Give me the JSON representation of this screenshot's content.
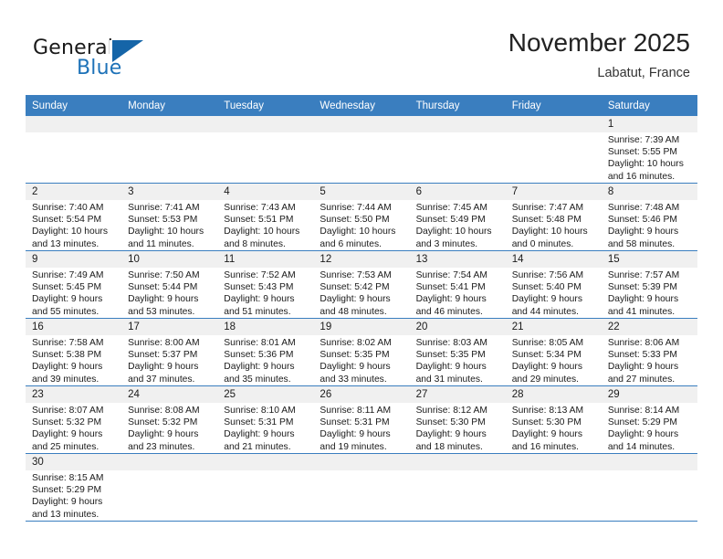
{
  "brand": {
    "name_part1": "General",
    "name_part2": "Blue",
    "logo_icon": "triangle-logo-icon"
  },
  "header": {
    "title": "November 2025",
    "location": "Labatut, France"
  },
  "calendar": {
    "weekday_headers": [
      "Sunday",
      "Monday",
      "Tuesday",
      "Wednesday",
      "Thursday",
      "Friday",
      "Saturday"
    ],
    "accent_color": "#3a7ebf",
    "daynum_band_color": "#f0f0f0",
    "weeks": [
      [
        {
          "day": "",
          "empty": true,
          "sunrise": "",
          "sunset": "",
          "daylight1": "",
          "daylight2": ""
        },
        {
          "day": "",
          "empty": true,
          "sunrise": "",
          "sunset": "",
          "daylight1": "",
          "daylight2": ""
        },
        {
          "day": "",
          "empty": true,
          "sunrise": "",
          "sunset": "",
          "daylight1": "",
          "daylight2": ""
        },
        {
          "day": "",
          "empty": true,
          "sunrise": "",
          "sunset": "",
          "daylight1": "",
          "daylight2": ""
        },
        {
          "day": "",
          "empty": true,
          "sunrise": "",
          "sunset": "",
          "daylight1": "",
          "daylight2": ""
        },
        {
          "day": "",
          "empty": true,
          "sunrise": "",
          "sunset": "",
          "daylight1": "",
          "daylight2": ""
        },
        {
          "day": "1",
          "empty": false,
          "sunrise": "Sunrise: 7:39 AM",
          "sunset": "Sunset: 5:55 PM",
          "daylight1": "Daylight: 10 hours",
          "daylight2": "and 16 minutes."
        }
      ],
      [
        {
          "day": "2",
          "empty": false,
          "sunrise": "Sunrise: 7:40 AM",
          "sunset": "Sunset: 5:54 PM",
          "daylight1": "Daylight: 10 hours",
          "daylight2": "and 13 minutes."
        },
        {
          "day": "3",
          "empty": false,
          "sunrise": "Sunrise: 7:41 AM",
          "sunset": "Sunset: 5:53 PM",
          "daylight1": "Daylight: 10 hours",
          "daylight2": "and 11 minutes."
        },
        {
          "day": "4",
          "empty": false,
          "sunrise": "Sunrise: 7:43 AM",
          "sunset": "Sunset: 5:51 PM",
          "daylight1": "Daylight: 10 hours",
          "daylight2": "and 8 minutes."
        },
        {
          "day": "5",
          "empty": false,
          "sunrise": "Sunrise: 7:44 AM",
          "sunset": "Sunset: 5:50 PM",
          "daylight1": "Daylight: 10 hours",
          "daylight2": "and 6 minutes."
        },
        {
          "day": "6",
          "empty": false,
          "sunrise": "Sunrise: 7:45 AM",
          "sunset": "Sunset: 5:49 PM",
          "daylight1": "Daylight: 10 hours",
          "daylight2": "and 3 minutes."
        },
        {
          "day": "7",
          "empty": false,
          "sunrise": "Sunrise: 7:47 AM",
          "sunset": "Sunset: 5:48 PM",
          "daylight1": "Daylight: 10 hours",
          "daylight2": "and 0 minutes."
        },
        {
          "day": "8",
          "empty": false,
          "sunrise": "Sunrise: 7:48 AM",
          "sunset": "Sunset: 5:46 PM",
          "daylight1": "Daylight: 9 hours",
          "daylight2": "and 58 minutes."
        }
      ],
      [
        {
          "day": "9",
          "empty": false,
          "sunrise": "Sunrise: 7:49 AM",
          "sunset": "Sunset: 5:45 PM",
          "daylight1": "Daylight: 9 hours",
          "daylight2": "and 55 minutes."
        },
        {
          "day": "10",
          "empty": false,
          "sunrise": "Sunrise: 7:50 AM",
          "sunset": "Sunset: 5:44 PM",
          "daylight1": "Daylight: 9 hours",
          "daylight2": "and 53 minutes."
        },
        {
          "day": "11",
          "empty": false,
          "sunrise": "Sunrise: 7:52 AM",
          "sunset": "Sunset: 5:43 PM",
          "daylight1": "Daylight: 9 hours",
          "daylight2": "and 51 minutes."
        },
        {
          "day": "12",
          "empty": false,
          "sunrise": "Sunrise: 7:53 AM",
          "sunset": "Sunset: 5:42 PM",
          "daylight1": "Daylight: 9 hours",
          "daylight2": "and 48 minutes."
        },
        {
          "day": "13",
          "empty": false,
          "sunrise": "Sunrise: 7:54 AM",
          "sunset": "Sunset: 5:41 PM",
          "daylight1": "Daylight: 9 hours",
          "daylight2": "and 46 minutes."
        },
        {
          "day": "14",
          "empty": false,
          "sunrise": "Sunrise: 7:56 AM",
          "sunset": "Sunset: 5:40 PM",
          "daylight1": "Daylight: 9 hours",
          "daylight2": "and 44 minutes."
        },
        {
          "day": "15",
          "empty": false,
          "sunrise": "Sunrise: 7:57 AM",
          "sunset": "Sunset: 5:39 PM",
          "daylight1": "Daylight: 9 hours",
          "daylight2": "and 41 minutes."
        }
      ],
      [
        {
          "day": "16",
          "empty": false,
          "sunrise": "Sunrise: 7:58 AM",
          "sunset": "Sunset: 5:38 PM",
          "daylight1": "Daylight: 9 hours",
          "daylight2": "and 39 minutes."
        },
        {
          "day": "17",
          "empty": false,
          "sunrise": "Sunrise: 8:00 AM",
          "sunset": "Sunset: 5:37 PM",
          "daylight1": "Daylight: 9 hours",
          "daylight2": "and 37 minutes."
        },
        {
          "day": "18",
          "empty": false,
          "sunrise": "Sunrise: 8:01 AM",
          "sunset": "Sunset: 5:36 PM",
          "daylight1": "Daylight: 9 hours",
          "daylight2": "and 35 minutes."
        },
        {
          "day": "19",
          "empty": false,
          "sunrise": "Sunrise: 8:02 AM",
          "sunset": "Sunset: 5:35 PM",
          "daylight1": "Daylight: 9 hours",
          "daylight2": "and 33 minutes."
        },
        {
          "day": "20",
          "empty": false,
          "sunrise": "Sunrise: 8:03 AM",
          "sunset": "Sunset: 5:35 PM",
          "daylight1": "Daylight: 9 hours",
          "daylight2": "and 31 minutes."
        },
        {
          "day": "21",
          "empty": false,
          "sunrise": "Sunrise: 8:05 AM",
          "sunset": "Sunset: 5:34 PM",
          "daylight1": "Daylight: 9 hours",
          "daylight2": "and 29 minutes."
        },
        {
          "day": "22",
          "empty": false,
          "sunrise": "Sunrise: 8:06 AM",
          "sunset": "Sunset: 5:33 PM",
          "daylight1": "Daylight: 9 hours",
          "daylight2": "and 27 minutes."
        }
      ],
      [
        {
          "day": "23",
          "empty": false,
          "sunrise": "Sunrise: 8:07 AM",
          "sunset": "Sunset: 5:32 PM",
          "daylight1": "Daylight: 9 hours",
          "daylight2": "and 25 minutes."
        },
        {
          "day": "24",
          "empty": false,
          "sunrise": "Sunrise: 8:08 AM",
          "sunset": "Sunset: 5:32 PM",
          "daylight1": "Daylight: 9 hours",
          "daylight2": "and 23 minutes."
        },
        {
          "day": "25",
          "empty": false,
          "sunrise": "Sunrise: 8:10 AM",
          "sunset": "Sunset: 5:31 PM",
          "daylight1": "Daylight: 9 hours",
          "daylight2": "and 21 minutes."
        },
        {
          "day": "26",
          "empty": false,
          "sunrise": "Sunrise: 8:11 AM",
          "sunset": "Sunset: 5:31 PM",
          "daylight1": "Daylight: 9 hours",
          "daylight2": "and 19 minutes."
        },
        {
          "day": "27",
          "empty": false,
          "sunrise": "Sunrise: 8:12 AM",
          "sunset": "Sunset: 5:30 PM",
          "daylight1": "Daylight: 9 hours",
          "daylight2": "and 18 minutes."
        },
        {
          "day": "28",
          "empty": false,
          "sunrise": "Sunrise: 8:13 AM",
          "sunset": "Sunset: 5:30 PM",
          "daylight1": "Daylight: 9 hours",
          "daylight2": "and 16 minutes."
        },
        {
          "day": "29",
          "empty": false,
          "sunrise": "Sunrise: 8:14 AM",
          "sunset": "Sunset: 5:29 PM",
          "daylight1": "Daylight: 9 hours",
          "daylight2": "and 14 minutes."
        }
      ],
      [
        {
          "day": "30",
          "empty": false,
          "sunrise": "Sunrise: 8:15 AM",
          "sunset": "Sunset: 5:29 PM",
          "daylight1": "Daylight: 9 hours",
          "daylight2": "and 13 minutes."
        },
        {
          "day": "",
          "empty": true,
          "sunrise": "",
          "sunset": "",
          "daylight1": "",
          "daylight2": ""
        },
        {
          "day": "",
          "empty": true,
          "sunrise": "",
          "sunset": "",
          "daylight1": "",
          "daylight2": ""
        },
        {
          "day": "",
          "empty": true,
          "sunrise": "",
          "sunset": "",
          "daylight1": "",
          "daylight2": ""
        },
        {
          "day": "",
          "empty": true,
          "sunrise": "",
          "sunset": "",
          "daylight1": "",
          "daylight2": ""
        },
        {
          "day": "",
          "empty": true,
          "sunrise": "",
          "sunset": "",
          "daylight1": "",
          "daylight2": ""
        },
        {
          "day": "",
          "empty": true,
          "sunrise": "",
          "sunset": "",
          "daylight1": "",
          "daylight2": ""
        }
      ]
    ]
  }
}
